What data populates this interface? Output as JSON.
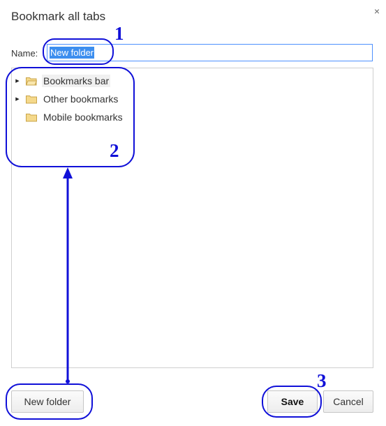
{
  "dialog": {
    "title": "Bookmark all tabs",
    "close_glyph": "×"
  },
  "name_field": {
    "label": "Name:",
    "value": "New folder"
  },
  "tree": {
    "items": [
      {
        "label": "Bookmarks bar",
        "expandable": true,
        "icon": "folder-open-icon",
        "selected": true
      },
      {
        "label": "Other bookmarks",
        "expandable": true,
        "icon": "folder-icon",
        "selected": false
      },
      {
        "label": "Mobile bookmarks",
        "expandable": false,
        "icon": "folder-icon",
        "selected": false
      }
    ]
  },
  "buttons": {
    "new_folder": "New folder",
    "save": "Save",
    "cancel": "Cancel"
  },
  "annotations": {
    "step1": "1",
    "step2": "2",
    "step3": "3",
    "color": "#1010d8"
  },
  "colors": {
    "selection": "#3c8eef",
    "input_border": "#4d90fe",
    "folder": "#f0c96a"
  }
}
